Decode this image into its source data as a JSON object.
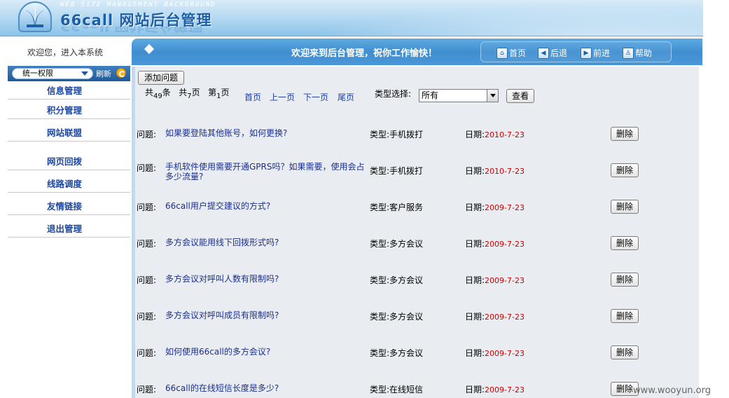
{
  "header": {
    "subtitle": "WEB SITE MANAGEMENT BACKGROUND",
    "title": "66call 网站后台管理",
    "logo_icon": "fountain-logo-icon"
  },
  "sidebar": {
    "welcome": "欢迎您，进入本系统",
    "permission": "统一权限",
    "refresh": "刷新",
    "items": [
      {
        "label": "信息管理"
      },
      {
        "label": "积分管理"
      },
      {
        "label": "网站联盟"
      },
      {
        "label": "网页回拨"
      },
      {
        "label": "线路调度"
      },
      {
        "label": "友情链接"
      },
      {
        "label": "退出管理"
      }
    ]
  },
  "navbar": {
    "welcome": "欢迎来到后台管理，祝你工作愉快！",
    "buttons": [
      {
        "label": "首页",
        "icon": "home-icon"
      },
      {
        "label": "后退",
        "icon": "back-icon"
      },
      {
        "label": "前进",
        "icon": "forward-icon"
      },
      {
        "label": "帮助",
        "icon": "help-icon"
      }
    ]
  },
  "toolbar": {
    "add_label": "添加问题",
    "total_prefix": "共",
    "total_count": "49",
    "total_unit": "条",
    "pages_prefix": "共",
    "pages_count": "7",
    "pages_unit": "页",
    "current_prefix": "第",
    "current_page": "1",
    "current_unit": "页",
    "first": "首页",
    "prev": "上一页",
    "next": "下一页",
    "last": "尾页",
    "type_label": "类型选择:",
    "type_selected": "所有",
    "query_label": "查看"
  },
  "questions": {
    "question_label": "问题:",
    "type_label": "类型:",
    "date_label": "日期:",
    "delete_label": "删除",
    "rows": [
      {
        "question": "如果要登陆其他账号，如何更换?",
        "type": "手机拨打",
        "date": "2010-7-23"
      },
      {
        "question": "手机软件使用需要开通GPRS吗？如果需要，使用会占多少流量?",
        "type": "手机拨打",
        "date": "2010-7-23"
      },
      {
        "question": "66call用户提交建议的方式?",
        "type": "客户服务",
        "date": "2009-7-23"
      },
      {
        "question": "多方会议能用线下回拨形式吗?",
        "type": "多方会议",
        "date": "2009-7-23"
      },
      {
        "question": "多方会议对呼叫人数有限制吗?",
        "type": "多方会议",
        "date": "2009-7-23"
      },
      {
        "question": "多方会议对呼叫成员有限制吗?",
        "type": "多方会议",
        "date": "2009-7-23"
      },
      {
        "question": "如何使用66call的多方会议?",
        "type": "多方会议",
        "date": "2009-7-23"
      },
      {
        "question": "66call的在线短信长度是多少?",
        "type": "在线短信",
        "date": "2009-7-23"
      }
    ]
  },
  "watermark": "www.wooyun.org"
}
